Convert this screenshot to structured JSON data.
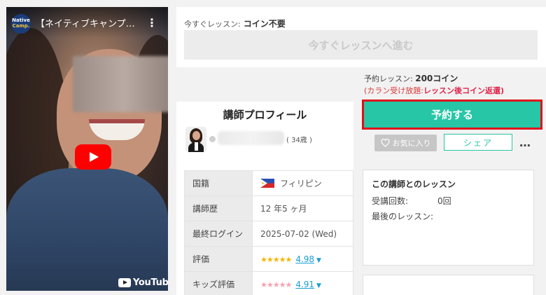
{
  "video": {
    "channel_logo_line1": "Native",
    "channel_logo_line2": "Camp.",
    "title": "【ネイティブキャンプ…",
    "brand": "YouTube"
  },
  "now_lesson": {
    "label": "今すぐレッスン:",
    "value": "コイン不要",
    "button": "今すぐレッスンへ進む"
  },
  "reservation": {
    "label": "予約レッスン:",
    "value": "200コイン",
    "note_prefix": "(カラン受け放題:",
    "note_emphasis": "レッスン後コイン返還)",
    "reserve_button": "予約する",
    "favorite_button": "お気に入り",
    "share_button": "シェア",
    "more": "…"
  },
  "profile": {
    "title": "講師プロフィール",
    "age": "( 34歳 )",
    "rows": [
      {
        "key": "国籍",
        "value": "フィリピン"
      },
      {
        "key": "講師歴",
        "value": "12 年5 ヶ月"
      },
      {
        "key": "最終ログイン",
        "value": "2025-07-02 (Wed)"
      },
      {
        "key": "評価",
        "value": "4.98"
      },
      {
        "key": "キッズ評価",
        "value": "4.91"
      }
    ]
  },
  "lesson_history": {
    "title": "この講師とのレッスン",
    "count_label": "受講回数:",
    "count_value": "0回",
    "last_label": "最後のレッスン:"
  },
  "colors": {
    "accent": "#27c6a6",
    "highlight_border": "#e0101b",
    "link": "#1a9fd8",
    "star": "#f5b50a",
    "kids_star": "#f4a3b4"
  }
}
